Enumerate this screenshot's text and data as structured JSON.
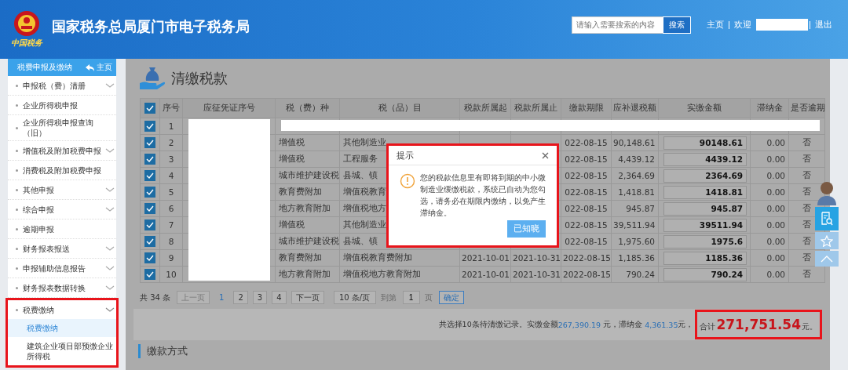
{
  "header": {
    "logo_caption": "中国税务",
    "title": "国家税务总局厦门市电子税务局",
    "search": {
      "placeholder": "请输入需要搜索的内容",
      "button": "搜索"
    },
    "home": "主页",
    "welcome": "欢迎",
    "user_redacted": true,
    "logout": "退出"
  },
  "sidebar": {
    "title": "税费申报及缴纳",
    "home_link": "主页",
    "items": [
      {
        "label": "申报税（费）清册",
        "expandable": true,
        "expanded": false,
        "annotated": false
      },
      {
        "label": "企业所得税申报",
        "expandable": false,
        "annotated": false
      },
      {
        "label": "企业所得税申报查询（旧）",
        "expandable": false,
        "annotated": false
      },
      {
        "label": "增值税及附加税费申报",
        "expandable": true,
        "expanded": false,
        "annotated": false
      },
      {
        "label": "消费税及附加税费申报",
        "expandable": false,
        "annotated": false
      },
      {
        "label": "其他申报",
        "expandable": true,
        "expanded": false,
        "annotated": false
      },
      {
        "label": "综合申报",
        "expandable": true,
        "expanded": false,
        "annotated": false
      },
      {
        "label": "逾期申报",
        "expandable": false,
        "annotated": false
      },
      {
        "label": "财务报表报送",
        "expandable": true,
        "expanded": false,
        "annotated": false
      },
      {
        "label": "申报辅助信息报告",
        "expandable": true,
        "expanded": false,
        "annotated": false
      },
      {
        "label": "财务报表数据转换",
        "expandable": true,
        "expanded": false,
        "annotated": false
      },
      {
        "label": "税费缴纳",
        "expandable": true,
        "expanded": true,
        "annotated": true,
        "children": [
          {
            "label": "税费缴纳",
            "selected": true
          },
          {
            "label": "建筑企业项目部预缴企业所得税",
            "selected": false
          }
        ]
      }
    ]
  },
  "page": {
    "title": "清缴税款"
  },
  "table": {
    "all_checked": true,
    "voucher_redacted": true,
    "columns": [
      "序号",
      "应征凭证序号",
      "税（费）种",
      "税（品）目",
      "税款所属起",
      "税款所属止",
      "缴款期限",
      "应补退税额",
      "实缴金额",
      "滞纳金",
      "是否逾期"
    ],
    "rows": [
      {
        "checked": true,
        "index": "1",
        "redacted": true
      },
      {
        "checked": true,
        "index": "2",
        "tax_type": "增值税",
        "tax_item": "其他制造业",
        "deadline": "022-08-15",
        "amount_due": "90,148.61",
        "amount_paid": "90148.61",
        "late_fee": "0.00",
        "overdue": "否"
      },
      {
        "checked": true,
        "index": "3",
        "tax_type": "增值税",
        "tax_item": "工程服务",
        "deadline": "022-08-15",
        "amount_due": "4,439.12",
        "amount_paid": "4439.12",
        "late_fee": "0.00",
        "overdue": "否"
      },
      {
        "checked": true,
        "index": "4",
        "tax_type": "城市维护建设税",
        "tax_item": "县城、镇",
        "deadline": "022-08-15",
        "amount_due": "2,364.69",
        "amount_paid": "2364.69",
        "late_fee": "0.00",
        "overdue": "否"
      },
      {
        "checked": true,
        "index": "5",
        "tax_type": "教育费附加",
        "tax_item": "增值税教育",
        "deadline": "022-08-15",
        "amount_due": "1,418.81",
        "amount_paid": "1418.81",
        "late_fee": "0.00",
        "overdue": "否"
      },
      {
        "checked": true,
        "index": "6",
        "tax_type": "地方教育附加",
        "tax_item": "增值税地方",
        "deadline": "022-08-15",
        "amount_due": "945.87",
        "amount_paid": "945.87",
        "late_fee": "0.00",
        "overdue": "否"
      },
      {
        "checked": true,
        "index": "7",
        "tax_type": "增值税",
        "tax_item": "其他制造业",
        "deadline": "022-08-15",
        "amount_due": "39,511.94",
        "amount_paid": "39511.94",
        "late_fee": "0.00",
        "overdue": "否"
      },
      {
        "checked": true,
        "index": "8",
        "tax_type": "城市维护建设税",
        "tax_item": "县城、镇",
        "deadline": "022-08-15",
        "amount_due": "1,975.60",
        "amount_paid": "1975.6",
        "late_fee": "0.00",
        "overdue": "否"
      },
      {
        "checked": true,
        "index": "9",
        "tax_type": "教育费附加",
        "tax_item": "增值税教育费附加",
        "period_start": "2021-10-01",
        "period_end": "2021-10-31",
        "deadline": "2022-08-15",
        "amount_due": "1,185.36",
        "amount_paid": "1185.36",
        "late_fee": "0.00",
        "overdue": "否"
      },
      {
        "checked": true,
        "index": "10",
        "tax_type": "地方教育附加",
        "tax_item": "增值税地方教育附加",
        "period_start": "2021-10-01",
        "period_end": "2021-10-31",
        "deadline": "2022-08-15",
        "amount_due": "790.24",
        "amount_paid": "790.24",
        "late_fee": "0.00",
        "overdue": "否"
      }
    ]
  },
  "pagination": {
    "total": "共 34 条",
    "prev": {
      "label": "上一页",
      "disabled": true
    },
    "pages": [
      {
        "label": "1",
        "selected": true
      },
      {
        "label": "2",
        "selected": false
      },
      {
        "label": "3",
        "selected": false
      },
      {
        "label": "4",
        "selected": false
      }
    ],
    "next": {
      "label": "下一页",
      "disabled": false
    },
    "page_size": "10 条/页",
    "goto_label": "到第",
    "goto_value": "1",
    "page_unit": "页",
    "confirm": "确定"
  },
  "summary": {
    "text": "共选择10条待清缴记录。实缴金额",
    "paid": "267,390.19",
    "middle": " 元，滞纳金 ",
    "late_fee": "4,361.35",
    "end": "元，",
    "annotated": true,
    "total_label": "合计",
    "total": "271,751.54",
    "total_unit": "元。"
  },
  "section": {
    "title": "缴款方式"
  },
  "dialog": {
    "title": "提示",
    "message": "您的税款信息里有即将到期的中小微制造业缓缴税款，系统已自动为您勾选，请务必在期限内缴纳，以免产生滞纳金。",
    "button": "已知晓",
    "annotated": true
  }
}
